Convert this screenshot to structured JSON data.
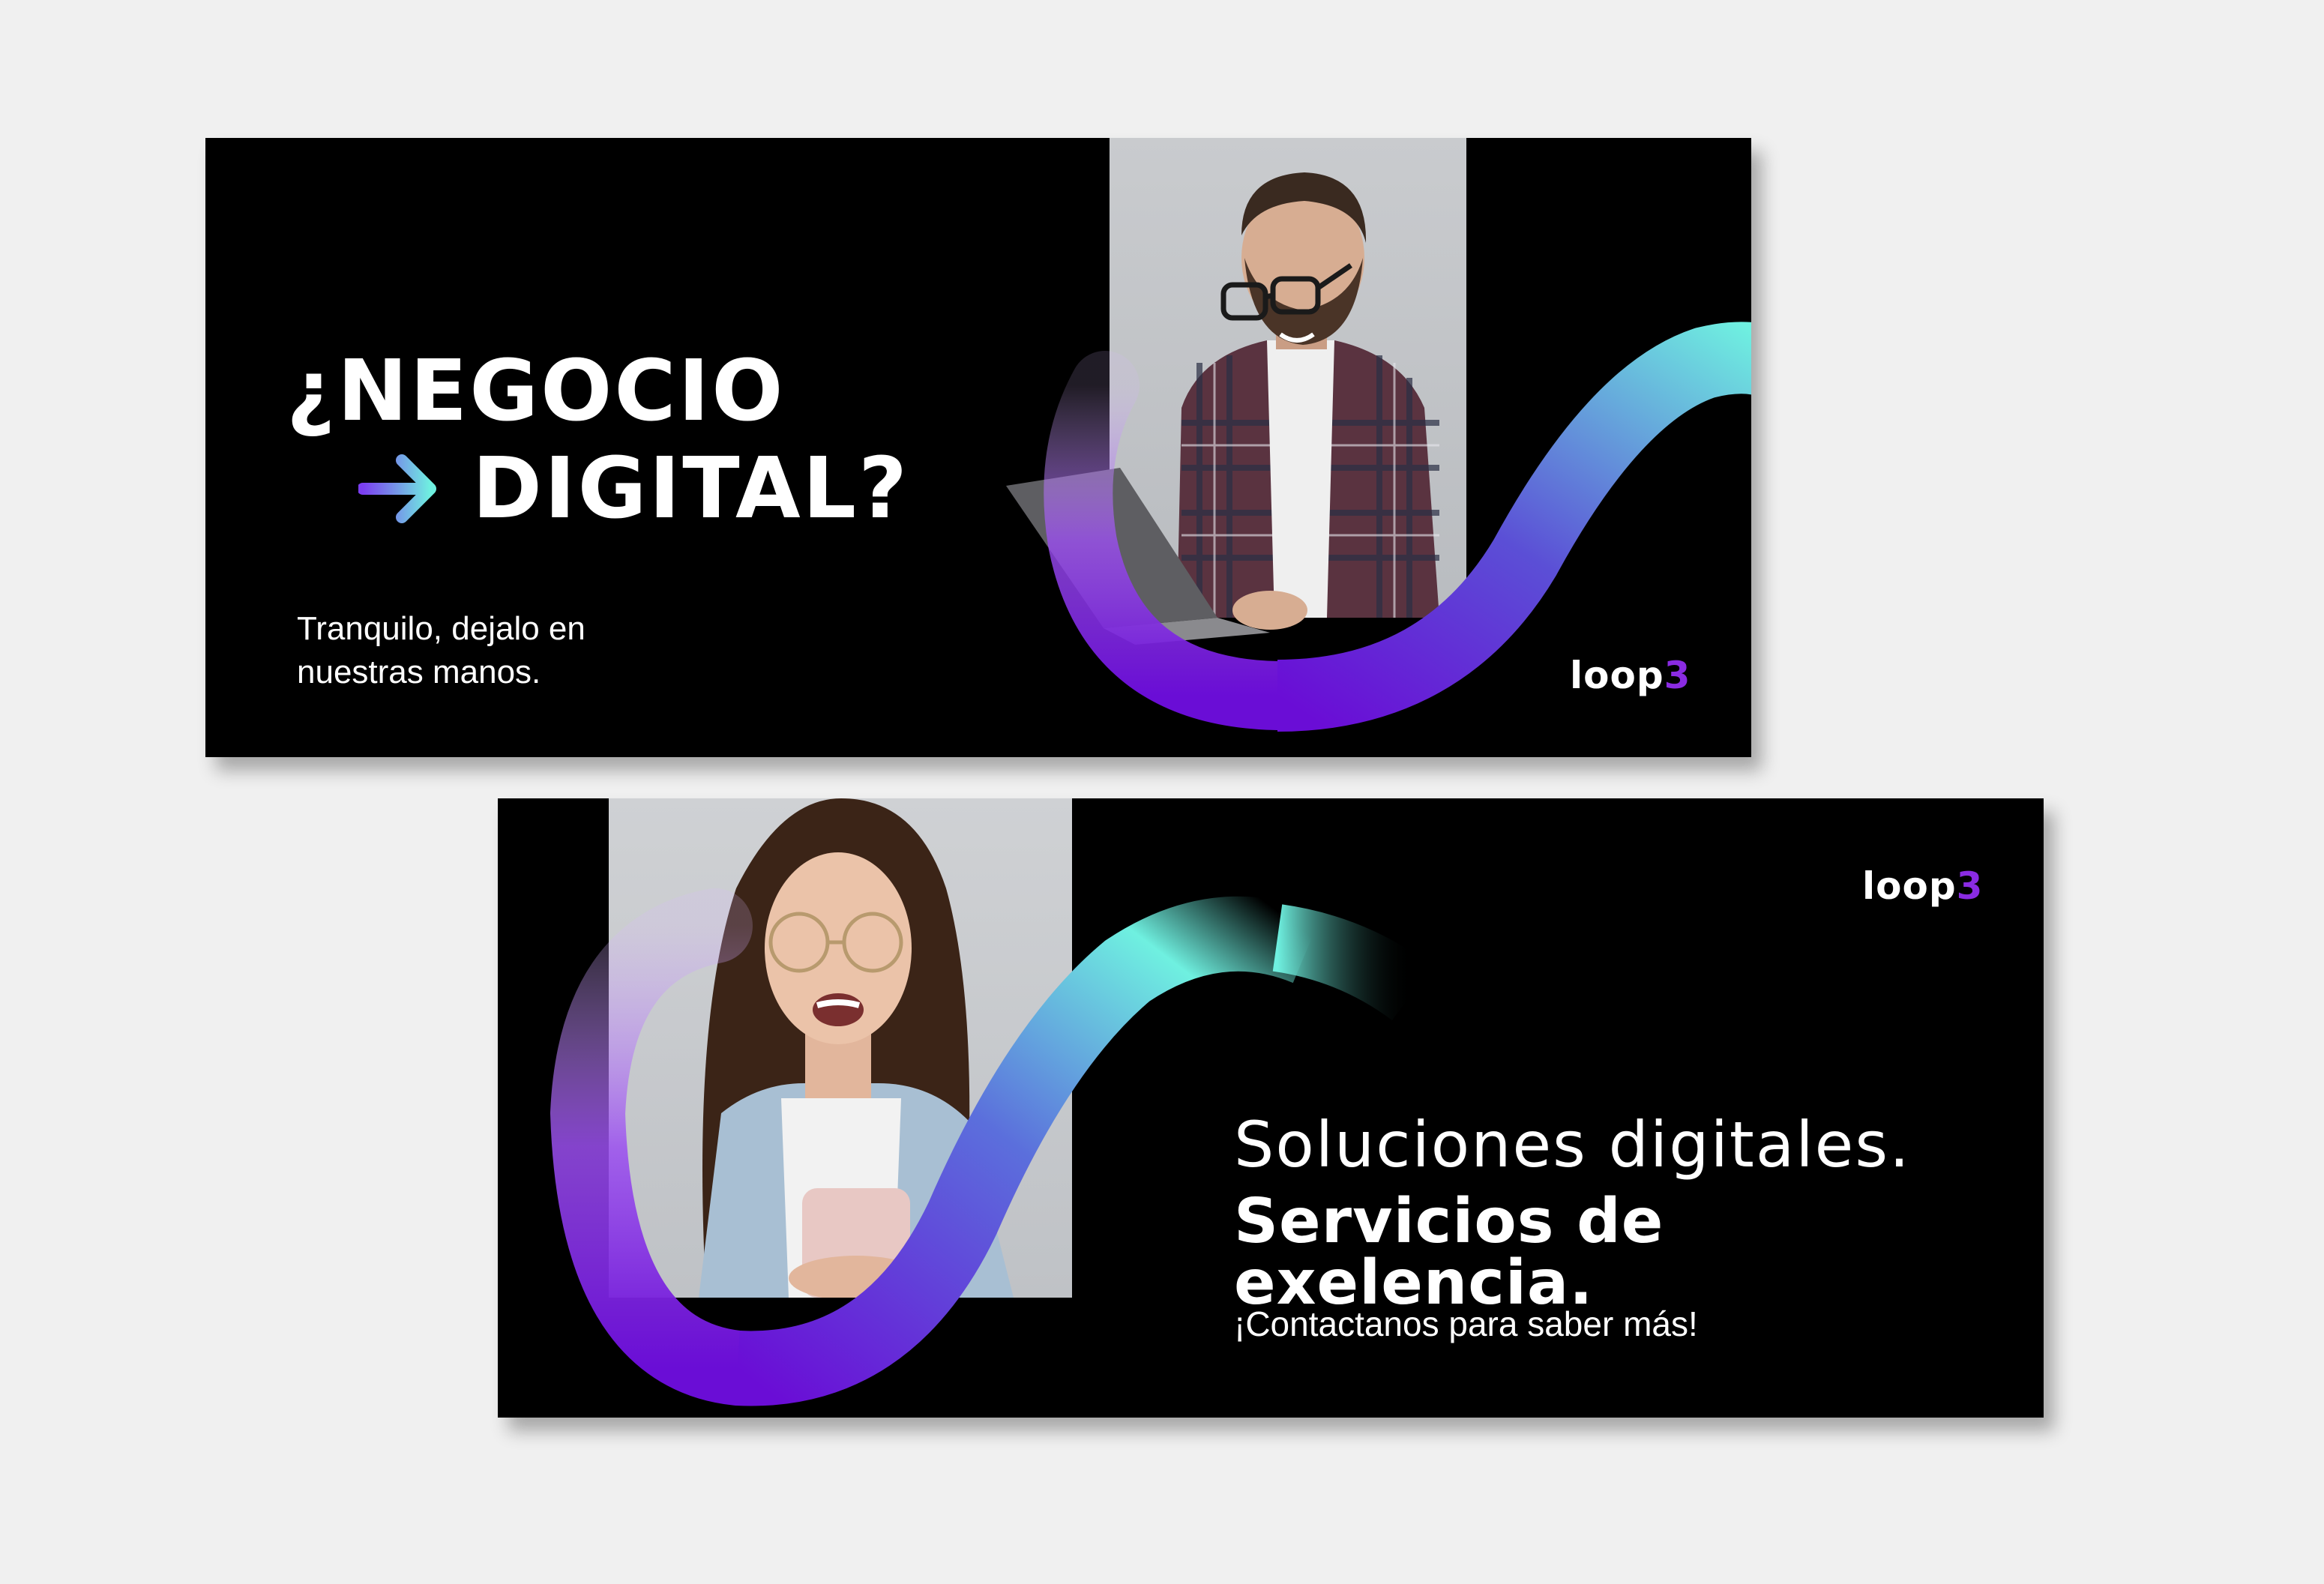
{
  "banner1": {
    "headline_line1": "¿NEGOCIO",
    "headline_line2": "DIGITAL?",
    "arrow_icon": "arrow-right-icon",
    "subtext": "Tranquilo, dejalo en nuestras manos.",
    "logo_text": "loop",
    "logo_num": "3"
  },
  "banner2": {
    "headline_line1": "Soluciones digitales.",
    "headline_line2": "Servicios de exelencia.",
    "subtext": "¡Contactanos para saber más!",
    "logo_text": "loop",
    "logo_num": "3"
  },
  "colors": {
    "background": "#f0f0f0",
    "banner": "#000000",
    "accent_purple": "#6a0dd6",
    "accent_cyan": "#6ff0e0",
    "logo_purple": "#8a2be2"
  }
}
